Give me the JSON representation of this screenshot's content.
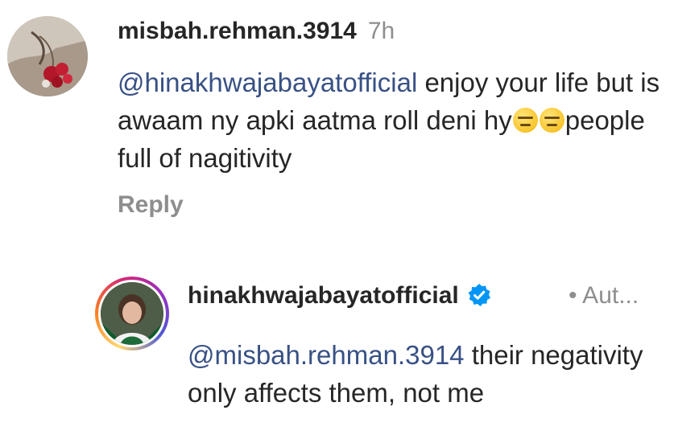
{
  "comment": {
    "username": "misbah.rehman.3914",
    "time": "7h",
    "mention": "@hinakhwajabayatofficial",
    "text_part1": " enjoy your life but is awaam ny apki aatma roll deni hy",
    "emoji_name": "expressionless-face-icon",
    "text_part2": "people full of nagitivity",
    "reply_label": "Reply"
  },
  "reply_comment": {
    "username": "hinakhwajabayatofficial",
    "author_label": "• Aut...",
    "mention": "@misbah.rehman.3914",
    "text": " their negativity only affects them, not me"
  },
  "colors": {
    "text": "#262626",
    "muted": "#8e8e8e",
    "mention": "#385185",
    "verified": "#0095f6"
  }
}
